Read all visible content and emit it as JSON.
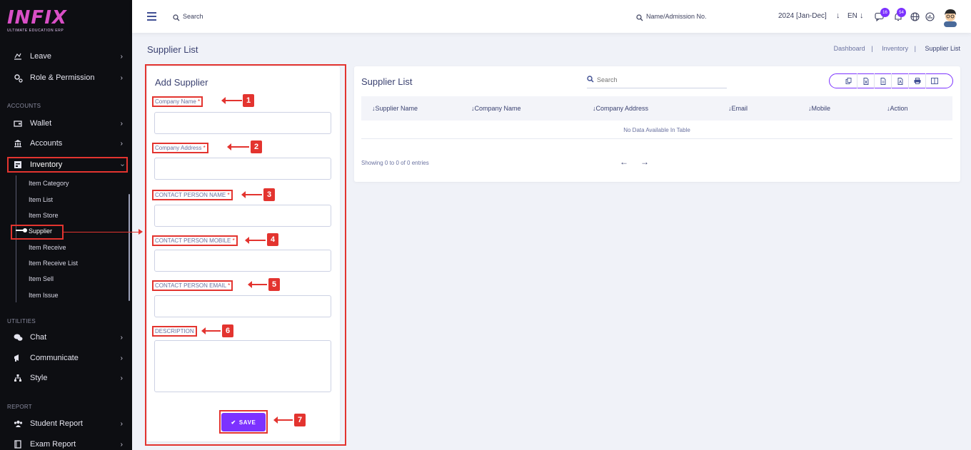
{
  "logo": {
    "brand": "INFIX",
    "tagline": "ULTIMATE EDUCATION ERP"
  },
  "sidebar": {
    "top_items": [
      {
        "label": "Leave"
      },
      {
        "label": "Role & Permission"
      }
    ],
    "sections": {
      "accounts": "ACCOUNTS",
      "utilities": "UTILITIES",
      "report": "REPORT"
    },
    "accounts_items": [
      {
        "label": "Wallet"
      },
      {
        "label": "Accounts"
      },
      {
        "label": "Inventory"
      }
    ],
    "inventory_sub": [
      "Item Category",
      "Item List",
      "Item Store",
      "Supplier",
      "Item Receive",
      "Item Receive List",
      "Item Sell",
      "Item Issue"
    ],
    "utility_items": [
      {
        "label": "Chat"
      },
      {
        "label": "Communicate"
      },
      {
        "label": "Style"
      }
    ],
    "report_items": [
      {
        "label": "Student Report"
      },
      {
        "label": "Exam Report"
      }
    ]
  },
  "topbar": {
    "search_placeholder": "Search",
    "admission_search": "Name/Admission No.",
    "session": "2024 [Jan-Dec]",
    "language": "EN",
    "chat_badge": "16",
    "notify_badge": "54"
  },
  "page": {
    "title": "Supplier List",
    "breadcrumb": [
      "Dashboard",
      "Inventory",
      "Supplier List"
    ]
  },
  "form": {
    "title": "Add Supplier",
    "fields": [
      {
        "label": "Company Name",
        "req": "*",
        "num": "1"
      },
      {
        "label": "Company Address",
        "req": "*",
        "num": "2"
      },
      {
        "label": "CONTACT PERSON NAME",
        "req": "*",
        "num": "3"
      },
      {
        "label": "CONTACT PERSON MOBILE",
        "req": "*",
        "num": "4"
      },
      {
        "label": "CONTACT PERSON EMAIL",
        "req": "*",
        "num": "5"
      },
      {
        "label": "DESCRIPTION",
        "req": "",
        "num": "6"
      }
    ],
    "save_label": "SAVE",
    "save_num": "7"
  },
  "table": {
    "title": "Supplier List",
    "search_placeholder": "Search",
    "columns": [
      "Supplier Name",
      "Company Name",
      "Company Address",
      "Email",
      "Mobile",
      "Action"
    ],
    "empty_text": "No Data Available In Table",
    "showing": "Showing 0 to 0 of 0 entries",
    "prev": "←",
    "next": "→"
  },
  "colors": {
    "accent": "#7c32ff",
    "annotation": "#e3342f",
    "sidebar_bg": "#0d0e12"
  }
}
